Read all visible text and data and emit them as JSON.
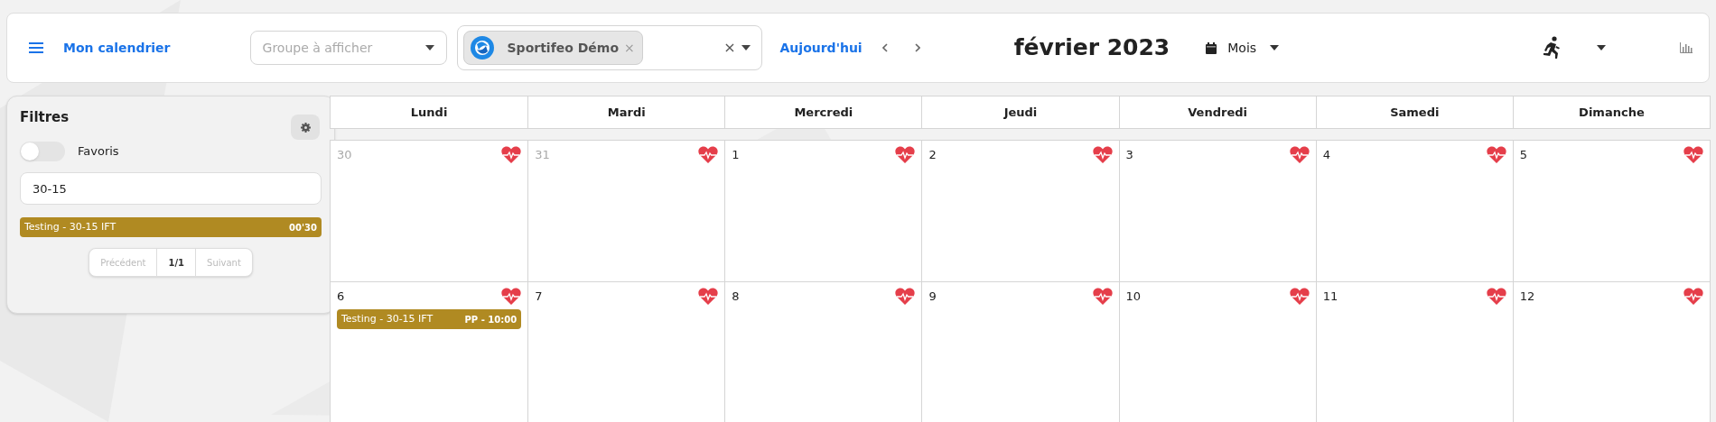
{
  "toolbar": {
    "calendar_link": "Mon calendrier",
    "group_select": {
      "placeholder": "Groupe à afficher"
    },
    "team_select": {
      "chips": [
        {
          "label": "Sportifeo Démo",
          "remove": "×"
        }
      ],
      "clear": "×"
    },
    "today_button": "Aujourd'hui",
    "title": "février 2023",
    "view_select": "Mois"
  },
  "filters": {
    "title": "Filtres",
    "favorites_toggle": {
      "label": "Favoris",
      "on": false
    },
    "search": {
      "value": "30-15"
    },
    "results": [
      {
        "title": "Testing - 30-15 IFT",
        "duration": "00'30",
        "color": "#b08a22"
      }
    ],
    "pagination": {
      "previous": "Précédent",
      "page": "1/1",
      "next": "Suivant"
    }
  },
  "calendar": {
    "weekdays": [
      "Lundi",
      "Mardi",
      "Mercredi",
      "Jeudi",
      "Vendredi",
      "Samedi",
      "Dimanche"
    ],
    "weeks": [
      [
        {
          "day": "30",
          "in_month": false
        },
        {
          "day": "31",
          "in_month": false
        },
        {
          "day": "1",
          "in_month": true
        },
        {
          "day": "2",
          "in_month": true
        },
        {
          "day": "3",
          "in_month": true
        },
        {
          "day": "4",
          "in_month": true
        },
        {
          "day": "5",
          "in_month": true
        }
      ],
      [
        {
          "day": "6",
          "in_month": true,
          "events": [
            {
              "title": "Testing - 30-15 IFT",
              "time": "PP - 10:00",
              "color": "#b08a22"
            }
          ]
        },
        {
          "day": "7",
          "in_month": true
        },
        {
          "day": "8",
          "in_month": true
        },
        {
          "day": "9",
          "in_month": true
        },
        {
          "day": "10",
          "in_month": true
        },
        {
          "day": "11",
          "in_month": true
        },
        {
          "day": "12",
          "in_month": true
        }
      ]
    ]
  }
}
